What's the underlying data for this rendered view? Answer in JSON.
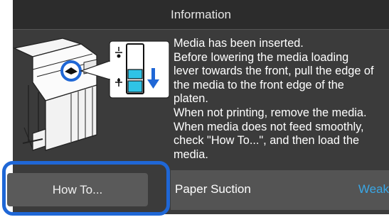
{
  "header": {
    "title": "Information"
  },
  "message": {
    "lines": [
      "Media has been inserted.",
      "Before lowering the media loading",
      "lever towards the front, pull the edge of",
      "the media to the front edge of the",
      "platen.",
      "When not printing, remove the media.",
      "When media does not feed smoothly,",
      "check \"How To...\", and then load the",
      "media."
    ]
  },
  "buttons": {
    "howto_label": "How To..."
  },
  "setting": {
    "label": "Paper Suction",
    "value": "Weak"
  },
  "icons": [
    "printer-illustration",
    "lever-icon",
    "arrow-down-icon"
  ],
  "colors": {
    "accent": "#1f67d6",
    "value_blue": "#3aa7e6",
    "fill_cyan": "#2fc3e6"
  }
}
